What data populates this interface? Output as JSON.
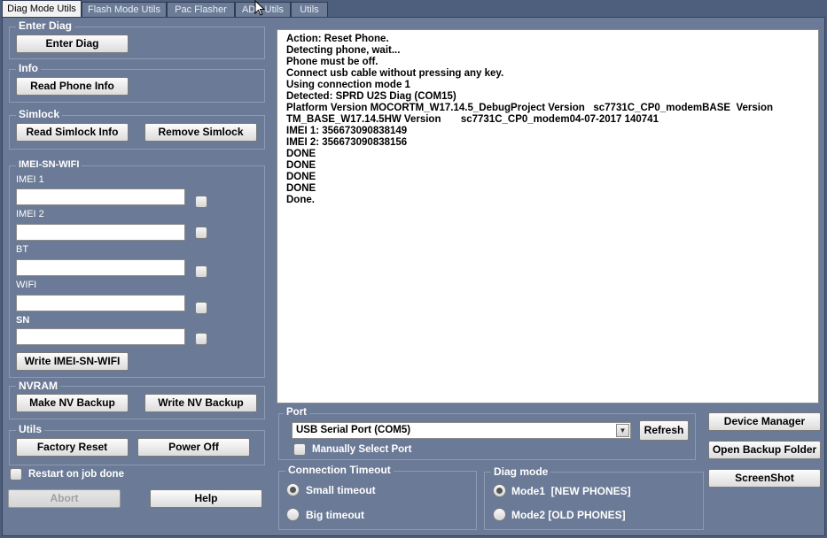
{
  "tabs": [
    "Diag Mode Utils",
    "Flash Mode Utils",
    "Pac Flasher",
    "ADB Utils",
    "Utils"
  ],
  "enter_diag": {
    "title": "Enter Diag",
    "button": "Enter Diag"
  },
  "info": {
    "title": "Info",
    "button": "Read Phone Info"
  },
  "simlock": {
    "title": "Simlock",
    "read_button": "Read Simlock Info",
    "remove_button": "Remove Simlock"
  },
  "imei": {
    "title": "IMEI-SN-WIFI",
    "fields": [
      {
        "label": "IMEI 1",
        "value": ""
      },
      {
        "label": "IMEI 2",
        "value": ""
      },
      {
        "label": "BT",
        "value": ""
      },
      {
        "label": "WIFI",
        "value": ""
      },
      {
        "label": "SN",
        "value": ""
      }
    ],
    "write_button": "Write IMEI-SN-WIFI"
  },
  "nvram": {
    "title": "NVRAM",
    "make_button": "Make NV Backup",
    "write_button": "Write NV Backup"
  },
  "utils": {
    "title": "Utils",
    "factory_reset": "Factory Reset",
    "power_off": "Power Off"
  },
  "restart_on_done": "Restart on job done",
  "abort_button": "Abort",
  "help_button": "Help",
  "log_lines": [
    "Action: Reset Phone.",
    "Detecting phone, wait...",
    "Phone must be off.",
    "Connect usb cable without pressing any key.",
    "Using connection mode 1",
    "Detected: SPRD U2S Diag (COM15)",
    "Platform Version MOCORTM_W17.14.5_DebugProject Version   sc7731C_CP0_modemBASE  Version",
    "TM_BASE_W17.14.5HW Version       sc7731C_CP0_modem04-07-2017 140741",
    "IMEI 1: 356673090838149",
    "IMEI 2: 356673090838156",
    "DONE",
    "DONE",
    "DONE",
    "DONE",
    "Done."
  ],
  "port": {
    "title": "Port",
    "selected": "USB Serial Port (COM5)",
    "refresh_button": "Refresh",
    "manual_select": "Manually Select Port"
  },
  "connection_timeout": {
    "title": "Connection Timeout",
    "options": [
      "Small timeout",
      "Big timeout"
    ],
    "selected_index": 0
  },
  "diag_mode": {
    "title": "Diag mode",
    "options": [
      "Mode1  [NEW PHONES]",
      "Mode2 [OLD PHONES]"
    ],
    "selected_index": 0
  },
  "side_buttons": {
    "device_manager": "Device Manager",
    "open_backup": "Open Backup Folder",
    "screenshot": "ScreenShot"
  },
  "colors": {
    "window_bg": "#4e5f7d",
    "panel_bg": "#6b7a96",
    "log_bg": "#ffffff",
    "active_tab": "#f2f2f2"
  }
}
